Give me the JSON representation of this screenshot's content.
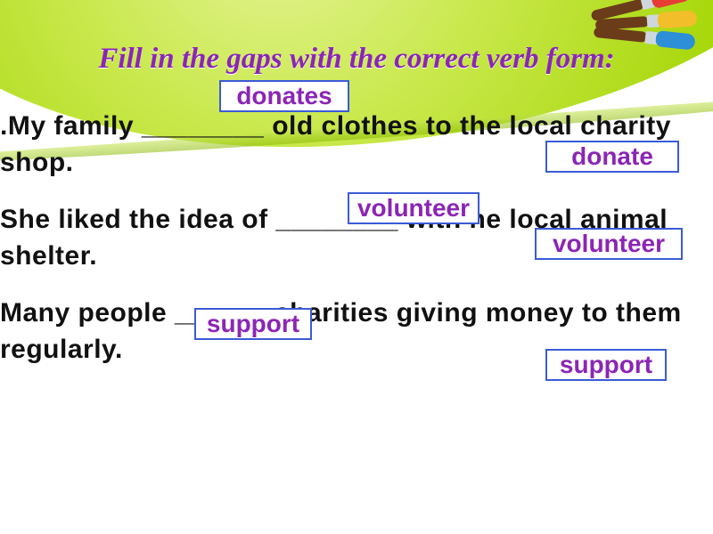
{
  "title": "Fill in the gaps with the correct verb form:",
  "sentences": {
    "s1": ".My family ________ old clothes to the local charity shop.",
    "s2": "She liked the idea of ________ with he local animal shelter.",
    "s3": "Many people ______ charities giving  money to them regularly."
  },
  "answers": {
    "donates": "donates",
    "donate": "donate",
    "volunteer_filled": "volunteer",
    "volunteer_hint": "volunteer",
    "support_filled": "support",
    "support_hint": "support"
  }
}
